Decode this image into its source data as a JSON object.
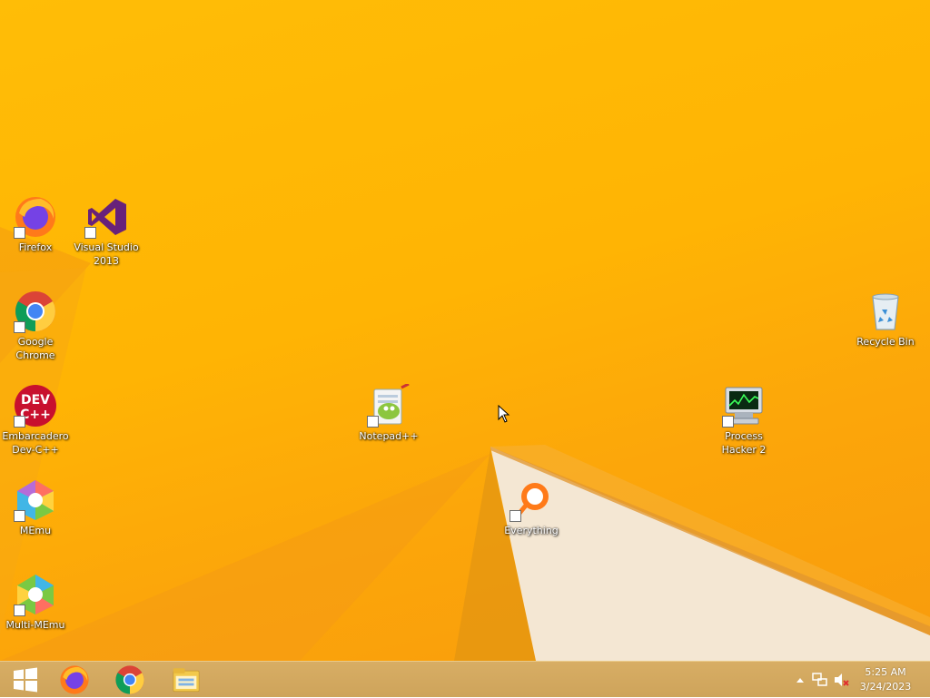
{
  "desktop": {
    "icons": [
      {
        "label": "Firefox",
        "icon": "firefox-icon"
      },
      {
        "label": "Visual Studio\n2013",
        "icon": "visual-studio-icon"
      },
      {
        "label": "Google\nChrome",
        "icon": "chrome-icon"
      },
      {
        "label": "Embarcadero\nDev-C++",
        "icon": "dev-cpp-icon"
      },
      {
        "label": "MEmu",
        "icon": "memu-icon"
      },
      {
        "label": "Multi-MEmu",
        "icon": "multi-memu-icon"
      },
      {
        "label": "Notepad++",
        "icon": "notepad-plus-plus-icon"
      },
      {
        "label": "Everything",
        "icon": "everything-search-icon"
      },
      {
        "label": "Process\nHacker 2",
        "icon": "process-hacker-icon"
      },
      {
        "label": "Recycle Bin",
        "icon": "recycle-bin-icon"
      }
    ],
    "devcpp_badge": "DEV\nC++"
  },
  "taskbar": {
    "start": "windows-start-icon",
    "pinned": [
      "firefox-icon",
      "chrome-icon",
      "file-explorer-icon"
    ]
  },
  "tray": {
    "time": "5:25 AM",
    "date": "3/24/2023",
    "icons": [
      "show-hidden-icons-chevron",
      "network-icon",
      "volume-muted-icon"
    ]
  },
  "colors": {
    "wallpaper": "#ffb404",
    "taskbar": "#d4a95c"
  }
}
